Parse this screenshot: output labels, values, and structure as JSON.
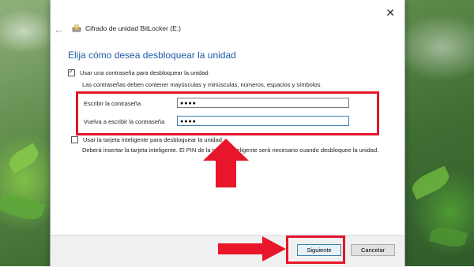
{
  "window": {
    "title": "Cifrado de unidad BitLocker (E:)",
    "close_glyph": "✕",
    "back_glyph": "←"
  },
  "main": {
    "heading": "Elija cómo desea desbloquear la unidad",
    "password_option": {
      "label": "Usar una contraseña para desbloquear la unidad",
      "checked": true,
      "info": "Las contraseñas deben contener mayúsculas y minúsculas, números, espacios y símbolos.",
      "enter_label": "Escribir la contraseña",
      "enter_value": "●●●●",
      "reenter_label": "Vuelva a escribir la contraseña",
      "reenter_value": "●●●●"
    },
    "smartcard_option": {
      "label": "Usar la tarjeta inteligente para desbloquear la unidad",
      "checked": false,
      "info": "Deberá insertar la tarjeta inteligente. El PIN de la tarjeta inteligente será necesario cuando desbloquee la unidad."
    }
  },
  "footer": {
    "next_label": "Siguiente",
    "cancel_label": "Cancelar"
  },
  "colors": {
    "accent": "#1e5aa8",
    "highlight_red": "#e4162a",
    "arrow_red": "#e8162a"
  },
  "icons": [
    "back-arrow-icon",
    "close-icon",
    "bitlocker-drive-icon",
    "checkbox-icon",
    "red-arrow-icon"
  ]
}
